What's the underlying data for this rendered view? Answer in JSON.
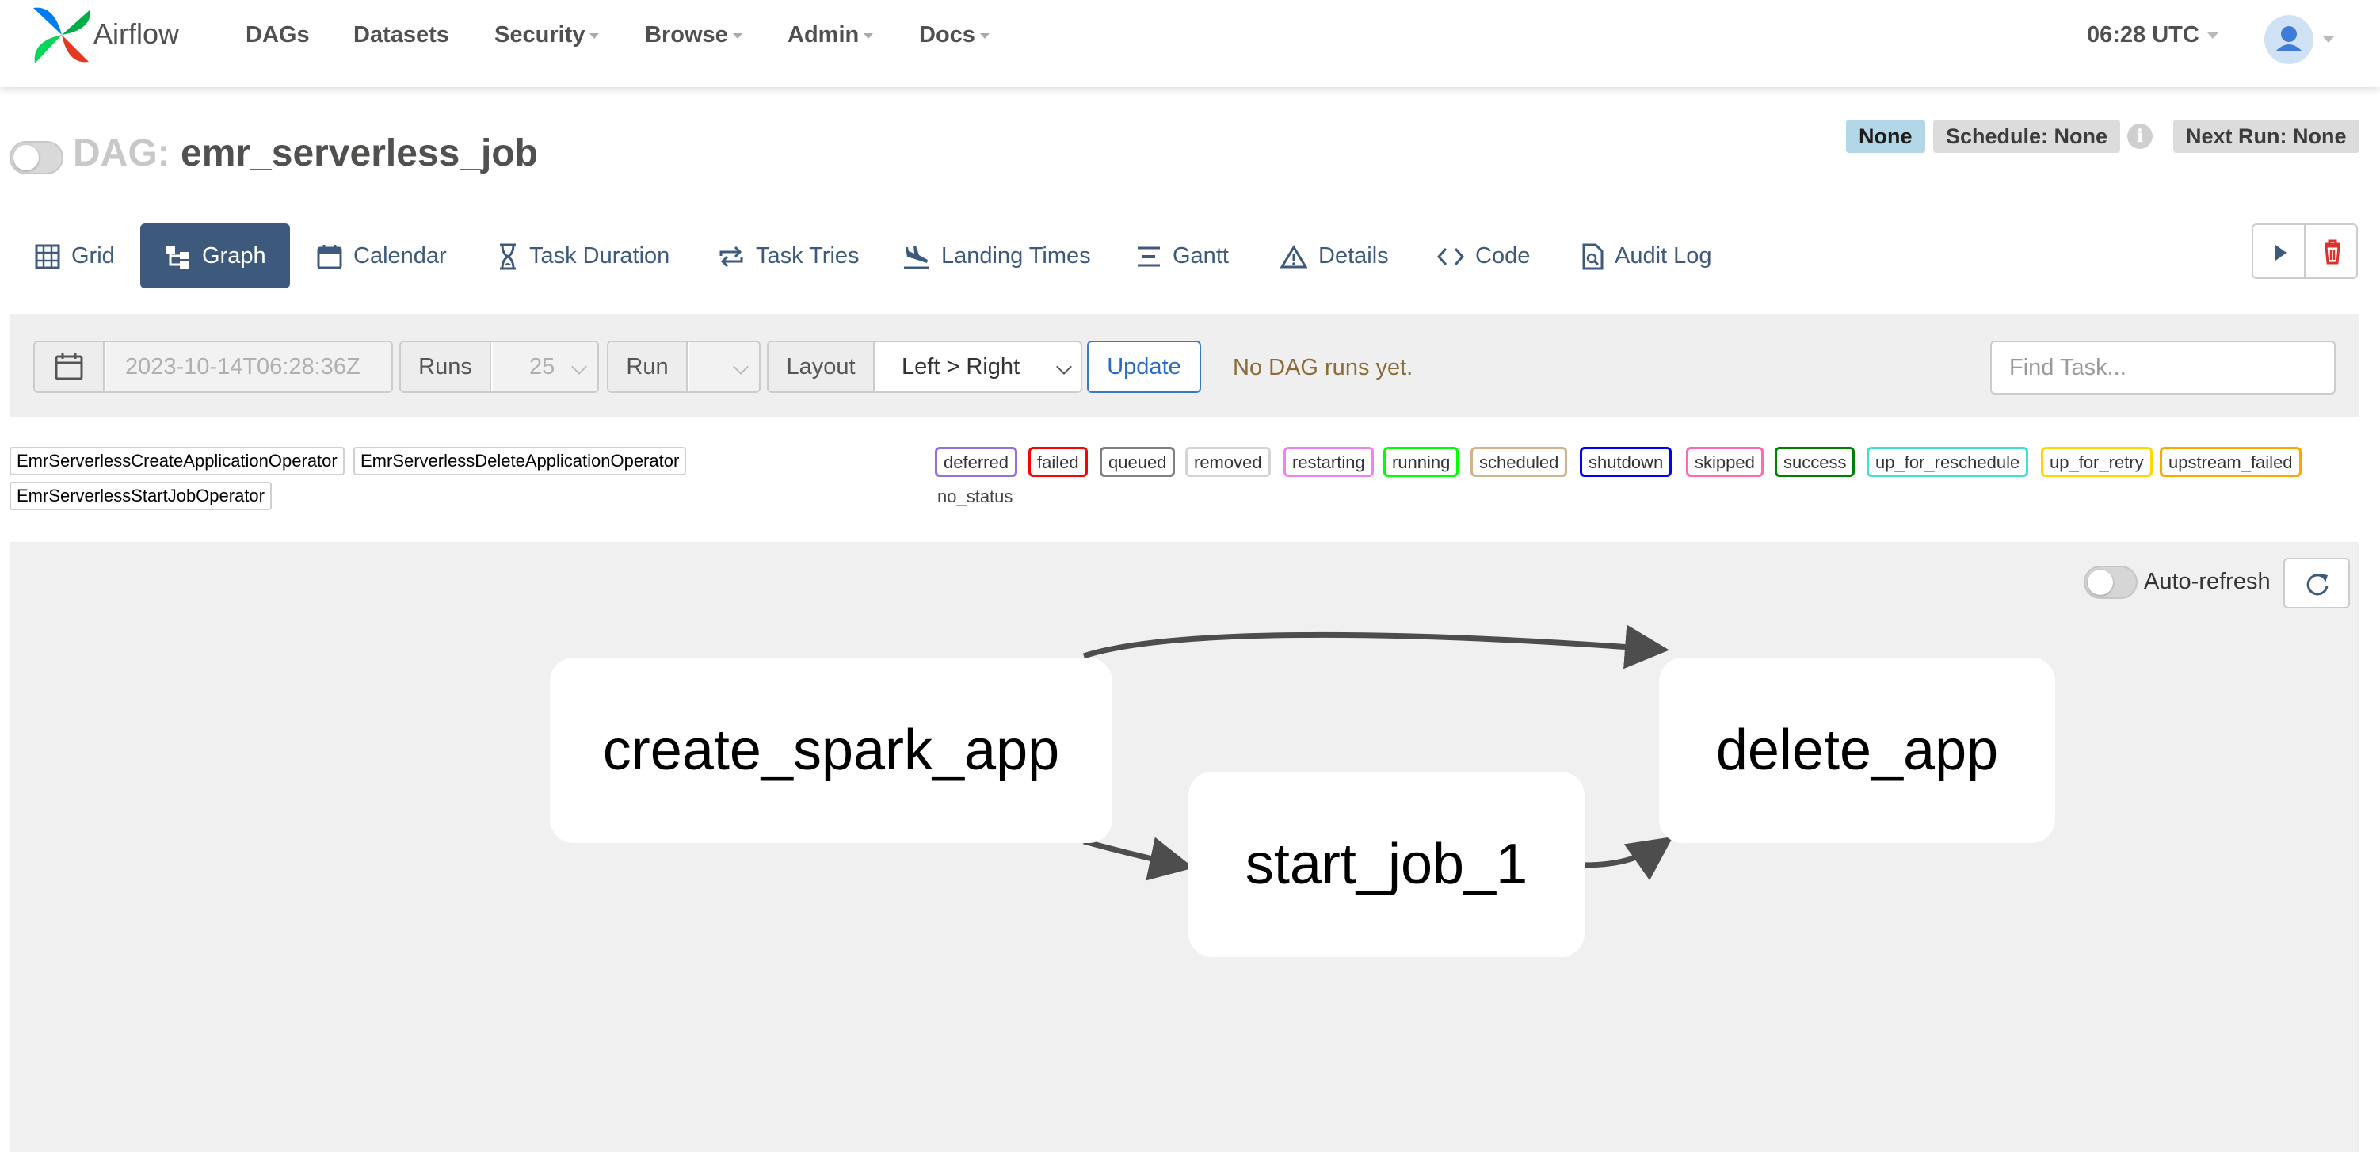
{
  "navbar": {
    "brand": "Airflow",
    "items": [
      {
        "label": "DAGs",
        "dropdown": false
      },
      {
        "label": "Datasets",
        "dropdown": false
      },
      {
        "label": "Security",
        "dropdown": true
      },
      {
        "label": "Browse",
        "dropdown": true
      },
      {
        "label": "Admin",
        "dropdown": true
      },
      {
        "label": "Docs",
        "dropdown": true
      }
    ],
    "clock": "06:28 UTC"
  },
  "dag": {
    "prefix": "DAG:",
    "name": "emr_serverless_job",
    "paused": true,
    "badges": {
      "none": "None",
      "schedule": "Schedule: None",
      "info": "i",
      "next_run": "Next Run: None"
    }
  },
  "tabs": [
    {
      "label": "Grid",
      "icon": "grid-icon",
      "active": false
    },
    {
      "label": "Graph",
      "icon": "graph-icon",
      "active": true
    },
    {
      "label": "Calendar",
      "icon": "calendar-icon",
      "active": false
    },
    {
      "label": "Task Duration",
      "icon": "hourglass-icon",
      "active": false
    },
    {
      "label": "Task Tries",
      "icon": "retry-icon",
      "active": false
    },
    {
      "label": "Landing Times",
      "icon": "plane-landing-icon",
      "active": false
    },
    {
      "label": "Gantt",
      "icon": "gantt-icon",
      "active": false
    },
    {
      "label": "Details",
      "icon": "warning-triangle-icon",
      "active": false
    },
    {
      "label": "Code",
      "icon": "code-icon",
      "active": false
    },
    {
      "label": "Audit Log",
      "icon": "audit-log-icon",
      "active": false
    }
  ],
  "filters": {
    "base_date": "2023-10-14T06:28:36Z",
    "runs_label": "Runs",
    "runs_value": "25",
    "run_label": "Run",
    "run_value": "",
    "layout_label": "Layout",
    "layout_value": "Left > Right",
    "update_label": "Update",
    "status_message": "No DAG runs yet.",
    "find_task_placeholder": "Find Task..."
  },
  "operators": [
    "EmrServerlessCreateApplicationOperator",
    "EmrServerlessDeleteApplicationOperator",
    "EmrServerlessStartJobOperator"
  ],
  "states": [
    {
      "label": "deferred",
      "color": "#9370db"
    },
    {
      "label": "failed",
      "color": "#ff0000"
    },
    {
      "label": "queued",
      "color": "#808080"
    },
    {
      "label": "removed",
      "color": "#d3d3d3"
    },
    {
      "label": "restarting",
      "color": "#ee82ee"
    },
    {
      "label": "running",
      "color": "#00ff00"
    },
    {
      "label": "scheduled",
      "color": "#d2b48c"
    },
    {
      "label": "shutdown",
      "color": "#0000ff"
    },
    {
      "label": "skipped",
      "color": "#ff69b4"
    },
    {
      "label": "success",
      "color": "#008000"
    },
    {
      "label": "up_for_reschedule",
      "color": "#40e0d0"
    },
    {
      "label": "up_for_retry",
      "color": "#ffd700"
    },
    {
      "label": "upstream_failed",
      "color": "#ffa500"
    }
  ],
  "no_status_label": "no_status",
  "graph": {
    "auto_refresh_label": "Auto-refresh",
    "auto_refresh_on": false,
    "nodes": [
      {
        "id": "create_spark_app",
        "label": "create_spark_app"
      },
      {
        "id": "start_job_1",
        "label": "start_job_1"
      },
      {
        "id": "delete_app",
        "label": "delete_app"
      }
    ],
    "edges": [
      {
        "from": "create_spark_app",
        "to": "delete_app"
      },
      {
        "from": "create_spark_app",
        "to": "start_job_1"
      },
      {
        "from": "start_job_1",
        "to": "delete_app"
      }
    ]
  }
}
